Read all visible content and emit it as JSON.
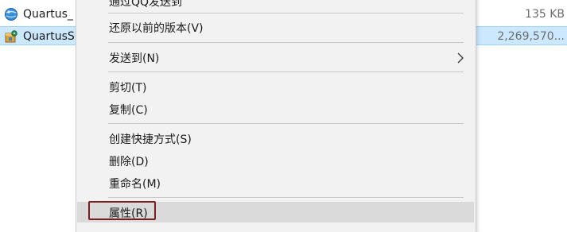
{
  "files": [
    {
      "name": "Quartus_",
      "size": "135 KB",
      "icon": "installer-globe-icon",
      "selected": false
    },
    {
      "name": "QuartusS",
      "size": "2,269,570...",
      "icon": "setup-package-icon",
      "selected": true
    }
  ],
  "context_menu": {
    "top_partial": "通过QQ发送到",
    "restore": "还原以前的版本(V)",
    "send_to": "发送到(N)",
    "cut": "剪切(T)",
    "copy": "复制(C)",
    "create_shortcut": "创建快捷方式(S)",
    "delete": "删除(D)",
    "rename": "重命名(M)",
    "properties": "属性(R)"
  },
  "colors": {
    "selection_bg": "#cce8ff",
    "menu_bg": "#f2f2f2",
    "hover_bg": "#dadada",
    "highlight_border": "#7a1f1f"
  }
}
